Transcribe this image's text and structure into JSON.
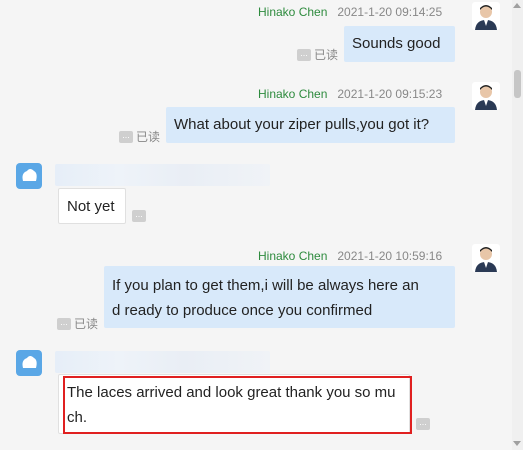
{
  "messages": [
    {
      "sender": "Hinako Chen",
      "time": "2021-1-20 09:14:25",
      "text": "Sounds good",
      "read": "已读"
    },
    {
      "sender": "Hinako Chen",
      "time": "2021-1-20 09:15:23",
      "text": "What about your ziper pulls,you got it?",
      "read": "已读"
    },
    {
      "text": "Not yet"
    },
    {
      "sender": "Hinako Chen",
      "time": "2021-1-20 10:59:16",
      "text_line1": "If you plan to get them,i will be always here an",
      "text_line2": "d ready to produce once you confirmed",
      "read": "已读"
    },
    {
      "text_line1": "The laces arrived and look great thank you so mu",
      "text_line2": "ch."
    }
  ],
  "icons": {
    "more": "more-dots-icon",
    "avatar_me": "user-avatar-icon",
    "avatar_other": "customer-avatar-icon"
  },
  "colors": {
    "bubble_me": "#d8e9fa",
    "sender_name": "#2e8b3e",
    "highlight": "#e02020"
  }
}
